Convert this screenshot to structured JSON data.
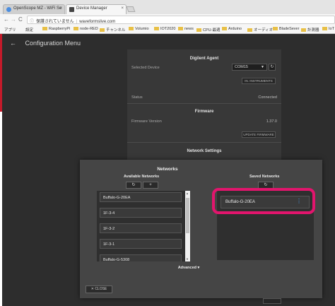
{
  "browser": {
    "tabs": [
      {
        "label": "OpenScope MZ - WiFi Se",
        "close": "×"
      },
      {
        "label": "Device Manager",
        "close": "×"
      }
    ],
    "nav": {
      "back": "←",
      "forward": "→",
      "reload": "C"
    },
    "address": {
      "info": "ⓘ",
      "security": "保護されていません",
      "separator": "|",
      "url": "waveformslive.com"
    },
    "bookmarks": [
      "アプリ",
      "設定",
      "RaspberryPi",
      "node-RED",
      "チャンネル",
      "Volumio",
      "IOT2020",
      "news",
      "CPU-最適",
      "Arduino",
      "オーディオ",
      "BladeSever",
      "計測器",
      "IoT"
    ]
  },
  "app": {
    "back_icon": "←",
    "title": "Configuration Menu",
    "digilent_agent": {
      "title": "Digilent Agent",
      "selected_device_label": "Selected Device",
      "selected_device_value": "COM15",
      "refresh": "↻",
      "instruments_btn": "IN. INSTRUMENTS",
      "status_label": "Status",
      "status_value": "Connected"
    },
    "firmware": {
      "title": "Firmware",
      "version_label": "Firmware Version",
      "version_value": "1.37.0",
      "update_btn": "UPDATE FIRMWARE"
    },
    "network_settings": {
      "title": "Network Settings"
    }
  },
  "networks_modal": {
    "title": "Networks",
    "available": {
      "title": "Available Networks",
      "refresh": "↻",
      "add": "+",
      "items": [
        "Buffalo-G-20EA",
        "1F-3-4",
        "1F-3-2",
        "1F-3-1",
        "Buffalo-G-5308"
      ],
      "scroll_up": "▲",
      "scroll_down": "▼"
    },
    "saved": {
      "title": "Saved Networks",
      "refresh": "↻",
      "items": [
        {
          "label": "Buffalo-G-20EA",
          "menu": "⋮"
        }
      ]
    },
    "advanced": "Advanced ▾",
    "close": "✕ CLOSE"
  },
  "colors": {
    "highlight": "#e2156d",
    "accent": "#4aa6ff",
    "background": "#2d2d2d"
  }
}
